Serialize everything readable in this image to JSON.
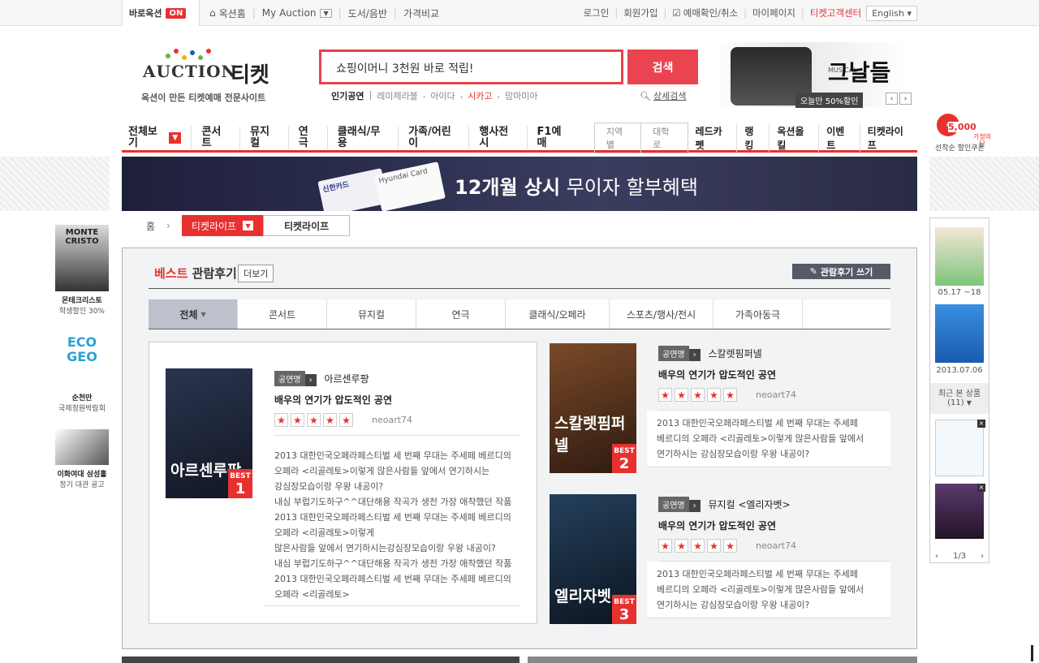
{
  "top": {
    "quick_label": "바로옥션",
    "on_badge": "ON",
    "links_left": [
      "옥션홈",
      "My Auction",
      "도서/음반",
      "가격비교"
    ],
    "links_right": [
      "로그인",
      "회원가입",
      "예매확인/취소",
      "마이페이지",
      "티켓고객센터"
    ],
    "lang": "English"
  },
  "logo": {
    "brand": "AUCTION",
    "ticket": "티켓",
    "sub": "옥션이 만든 티켓예매 전문사이트",
    "dot_colors": [
      "#6cb33f",
      "#e8312f",
      "#f3b400",
      "#1e5bb8",
      "#6cb33f",
      "#e8312f"
    ]
  },
  "search": {
    "value": "쇼핑이머니 3천원 바로 적립!",
    "button": "검색",
    "popular_label": "인기공연",
    "popular_items": [
      "레미제라블",
      "아이다",
      "시카고",
      "맘마미아"
    ],
    "advanced": "상세검색"
  },
  "top_banner": {
    "small": "MUSICAL",
    "title": "그날들",
    "sale": "오늘만 50%할인"
  },
  "coupon": {
    "amount": "5,000",
    "line1": "가정의 달",
    "line2": "선착순 할인쿠폰"
  },
  "gnb": {
    "all": "전체보기",
    "items": [
      "콘서트",
      "뮤지컬",
      "연극",
      "클래식/무용",
      "가족/어린이",
      "행사전시",
      "F1예매"
    ],
    "sub_tabs": [
      "지역별",
      "대학로"
    ],
    "right": [
      "레드카펫",
      "랭킹",
      "옥션올킬",
      "이벤트",
      "티켓라이프"
    ]
  },
  "card_banner": {
    "card1": "신한카드",
    "card2": "Hyundai Card",
    "text_bold": "12개월 상시",
    "text": "무이자 할부혜택"
  },
  "breadcrumb": {
    "home": "홈",
    "select": "티켓라이프",
    "current": "티켓라이프"
  },
  "section": {
    "title_red": "베스트",
    "title": "관람후기",
    "more": "더보기",
    "write": "관람후기 쓰기",
    "tabs": [
      "전체",
      "콘서트",
      "뮤지컬",
      "연극",
      "클래식/오페라",
      "스포츠/행사/전시",
      "가족아동극"
    ]
  },
  "reviews": [
    {
      "tag": "공연명",
      "name": "아르센루팡",
      "headline": "배우의 연기가 압도적인 공연",
      "stars": 5,
      "user": "neoart74",
      "poster_title": "아르센루팡",
      "rank": "1",
      "body": [
        "2013 대한민국오페라페스티벌 세 번째 무대는 주세페 베르디의",
        "오페라 <리골레토>이렇게 많은사람들 앞에서 연기하시는",
        "강심장모습이랑 우왕 내공이?",
        "내심 부럽기도하구^^대단해용 작곡가 생전 가장 애착했던 작품",
        "2013 대한민국오페라페스티벌 세 번째 무대는 주세페 베르디의",
        "오페라 <리골레토>이렇게",
        "많은사람들 앞에서 연기하시는강심장모습이랑 우왕 내공이?",
        "내심 부럽기도하구^^대단해용 작곡가 생전 가장 애착했던 작품",
        "2013 대한민국오페라페스티벌 세 번째 무대는 주세페 베르디의",
        "오페라 <리골레토>"
      ]
    },
    {
      "tag": "공연명",
      "name": "스칼렛핌퍼넬",
      "headline": "배우의 연기가 압도적인 공연",
      "stars": 5,
      "user": "neoart74",
      "poster_title": "스칼렛핌퍼넬",
      "rank": "2",
      "body": [
        "2013 대한민국오페라페스티벌 세 번째 무대는 주세페",
        "베르디의 오페라 <리골레토>이렇게 많은사람들 앞에서",
        "연기하시는 강심장모습이랑 우왕 내공이?"
      ]
    },
    {
      "tag": "공연명",
      "name": "뮤지컬 <엘리자벳>",
      "headline": "배우의 연기가 압도적인 공연",
      "stars": 5,
      "user": "neoart74",
      "poster_title": "엘리자벳",
      "rank": "3",
      "body": [
        "2013 대한민국오페라페스티벌 세 번째 무대는 주세페",
        "베르디의 오페라 <리골레토>이렇게 많은사람들 앞에서",
        "연기하시는 강심장모습이랑 우왕 내공이?"
      ]
    }
  ],
  "best_label": "BEST",
  "left_ads": [
    {
      "title": "MONTE CRISTO",
      "name": "몬테크리스토",
      "desc": "학생할인 30%"
    },
    {
      "title": "ECO GEO",
      "name": "순천만",
      "desc": "국제정원박람회"
    },
    {
      "title": "",
      "name": "이화여대 삼성홀",
      "desc": "정기 대관 공고"
    }
  ],
  "right_panel": {
    "item1_date": "05.17 ~18",
    "item2_date": "2013.07.06",
    "recent_label": "최근 본 상품",
    "recent_count": "(11)",
    "page": "1/3"
  }
}
